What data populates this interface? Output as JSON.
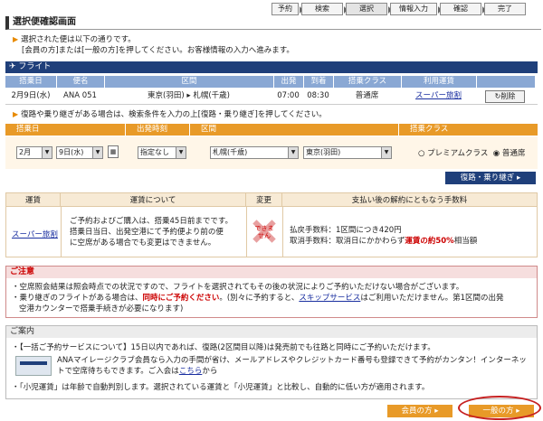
{
  "steps": [
    "予約",
    "検索",
    "選択",
    "情報入力",
    "確認",
    "完了"
  ],
  "page_title": "選択便確認画面",
  "intro": [
    "選択された便は以下の通りです。",
    "[会員の方]または[一般の方]を押してください。お客様情報の入力へ進みます。"
  ],
  "flight": {
    "header": "フライト",
    "columns": [
      "搭乗日",
      "便名",
      "区間",
      "出発",
      "到着",
      "搭乗クラス",
      "利用運賃"
    ],
    "row": {
      "date": "2月9日(水)",
      "flight_no": "ANA 051",
      "route": "東京(羽田) ▸ 札幌(千歳)",
      "dep": "07:00",
      "arr": "08:30",
      "class": "普通席",
      "fare": "スーパー旅割"
    },
    "delete_label": "削除"
  },
  "search": {
    "note": "復路や乗り継ぎがある場合は、検索条件を入力の上[復路・乗り継ぎ]を押してください。",
    "labels": [
      "搭乗日",
      "出発時刻",
      "区間",
      "搭乗クラス"
    ],
    "month": "2月",
    "day": "9日(水)",
    "time": "指定なし",
    "from": "札幌(千歳)",
    "to": "東京(羽田)",
    "class_options": [
      "プレミアムクラス",
      "普通席"
    ],
    "button": "復路・乗り継ぎ"
  },
  "fare": {
    "headers": [
      "運賃",
      "運賃について",
      "変更",
      "支払い後の解約にともなう手数料"
    ],
    "name": "スーパー旅割",
    "desc": [
      "ご予約およびご購入は、搭乗45日前までです。",
      "搭乗日当日、出発空港にて予約便より前の便",
      "に空席がある場合でも変更はできません。"
    ],
    "change": "できません",
    "fee1": "払戻手数料：1区間につき420円",
    "fee2_prefix": "取消手数料：取消日にかかわらず",
    "fee2_red": "運賃の約50%",
    "fee2_suffix": "相当額"
  },
  "notice": {
    "title": "ご注意",
    "l1": "空席照会結果は照会時点での状況ですので、フライトを選択されてもその後の状況によりご予約いただけない場合がございます。",
    "l2_pre": "乗り継ぎのフライトがある場合は、",
    "l2_red": "同時にご予約ください",
    "l2_mid": "。(別々に予約すると、",
    "l2_link": "スキップサービス",
    "l2_post": "はご利用いただけません。第1区間の出発",
    "l3": "空港カウンターで搭乗手続きが必要になります)"
  },
  "info": {
    "title": "ご案内",
    "l1": "【一括ご予約サービスについて】15日以内であれば、復路(2区間目以降)は発売前でも往路と同時にご予約いただけます。",
    "l2": "ANAマイレージクラブ会員なら入力の手間が省け、メールアドレスやクレジットカード番号も登録できて予約がカンタン！インターネッ",
    "l3_pre": "トで空席待ちもできます。ご入会は",
    "l3_link": "こちら",
    "l3_post": "から",
    "l4": "「小児運賃」は年齢で自動判別します。選択されている運賃と「小児運賃」と比較し、自動的に低い方が適用されます。"
  },
  "buttons": {
    "member": "会員の方",
    "general": "一般の方"
  },
  "colors": {
    "navy": "#1f3f7a",
    "orange": "#e89a28",
    "red": "#cc0000"
  }
}
